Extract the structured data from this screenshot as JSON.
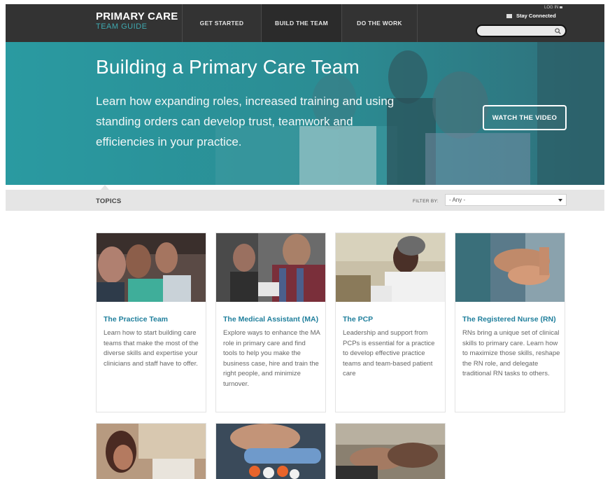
{
  "header": {
    "logo_top": "PRIMARY CARE",
    "logo_bottom": "TEAM GUIDE",
    "nav": [
      {
        "label": "GET STARTED"
      },
      {
        "label": "BUILD THE TEAM"
      },
      {
        "label": "DO THE WORK"
      }
    ],
    "login": "LOG IN",
    "stay_connected": "Stay Connected",
    "search_placeholder": ""
  },
  "hero": {
    "title": "Building a Primary Care Team",
    "subtitle": "Learn how expanding roles, increased training and using standing orders can develop trust, teamwork and efficiencies in your practice.",
    "button": "WATCH THE VIDEO"
  },
  "topics": {
    "label": "TOPICS",
    "filter_label": "FILTER BY:",
    "filter_value": "- Any -"
  },
  "cards": [
    {
      "title": "The Practice Team",
      "desc": "Learn how to start building care teams that make the most of the diverse skills and expertise your clinicians and staff have to offer."
    },
    {
      "title": "The Medical Assistant (MA)",
      "desc": "Explore ways to enhance the MA role in primary care and find tools to help you make the business case, hire and train the right people, and minimize turnover."
    },
    {
      "title": "The PCP",
      "desc": "Leadership and support from PCPs is essential for a practice to develop effective practice teams and team-based patient care"
    },
    {
      "title": "The Registered Nurse (RN)",
      "desc": "RNs bring a unique set of clinical skills to primary care. Learn how to maximize those skills, reshape the RN role, and delegate traditional RN tasks to others."
    }
  ],
  "colors": {
    "header_bg": "#333333",
    "accent_teal": "#2a8f96",
    "card_title": "#1f7f9c"
  }
}
